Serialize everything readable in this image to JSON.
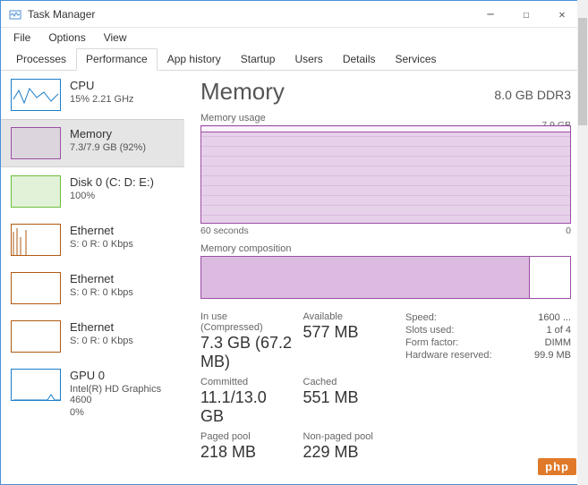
{
  "window": {
    "title": "Task Manager"
  },
  "menu": {
    "file": "File",
    "options": "Options",
    "view": "View"
  },
  "tabs": {
    "processes": "Processes",
    "performance": "Performance",
    "app_history": "App history",
    "startup": "Startup",
    "users": "Users",
    "details": "Details",
    "services": "Services"
  },
  "sidebar": [
    {
      "title": "CPU",
      "sub": "15% 2.21 GHz",
      "color": "#1b7dc9"
    },
    {
      "title": "Memory",
      "sub": "7.3/7.9 GB (92%)",
      "color": "#9b4fa5",
      "selected": true
    },
    {
      "title": "Disk 0 (C: D: E:)",
      "sub": "100%",
      "color": "#6bbf3a"
    },
    {
      "title": "Ethernet",
      "sub": "S: 0 R: 0 Kbps",
      "color": "#b05a12"
    },
    {
      "title": "Ethernet",
      "sub": "S: 0 R: 0 Kbps",
      "color": "#b05a12"
    },
    {
      "title": "Ethernet",
      "sub": "S: 0 R: 0 Kbps",
      "color": "#b05a12"
    },
    {
      "title": "GPU 0",
      "sub": "Intel(R) HD Graphics 4600",
      "sub2": "0%",
      "color": "#1b7dc9"
    }
  ],
  "main": {
    "heading": "Memory",
    "spec": "8.0 GB DDR3",
    "usage_label": "Memory usage",
    "usage_max": "7.9 GB",
    "x_left": "60 seconds",
    "x_right": "0",
    "comp_label": "Memory composition",
    "stats": {
      "in_use_label": "In use (Compressed)",
      "in_use": "7.3 GB (67.2 MB)",
      "available_label": "Available",
      "available": "577 MB",
      "committed_label": "Committed",
      "committed": "11.1/13.0 GB",
      "cached_label": "Cached",
      "cached": "551 MB",
      "paged_label": "Paged pool",
      "paged": "218 MB",
      "nonpaged_label": "Non-paged pool",
      "nonpaged": "229 MB"
    },
    "specs": [
      {
        "k": "Speed:",
        "v": "1600 ..."
      },
      {
        "k": "Slots used:",
        "v": "1 of 4"
      },
      {
        "k": "Form factor:",
        "v": "DIMM"
      },
      {
        "k": "Hardware reserved:",
        "v": "99.9 MB"
      }
    ]
  },
  "chart_data": {
    "type": "area",
    "title": "Memory usage",
    "ylabel": "GB",
    "ylim": [
      0,
      7.9
    ],
    "xlabel": "seconds",
    "xlim": [
      60,
      0
    ],
    "series": [
      {
        "name": "Memory",
        "values": [
          7.3,
          7.3,
          7.3,
          7.3,
          7.3,
          7.3,
          7.3,
          7.3,
          7.3,
          7.3,
          7.3,
          7.3
        ],
        "x": [
          60,
          55,
          50,
          45,
          40,
          35,
          30,
          25,
          20,
          15,
          10,
          5
        ]
      }
    ],
    "composition": {
      "in_use_gb": 7.3,
      "available_gb": 0.577,
      "total_gb": 7.9
    }
  },
  "watermark": "php"
}
